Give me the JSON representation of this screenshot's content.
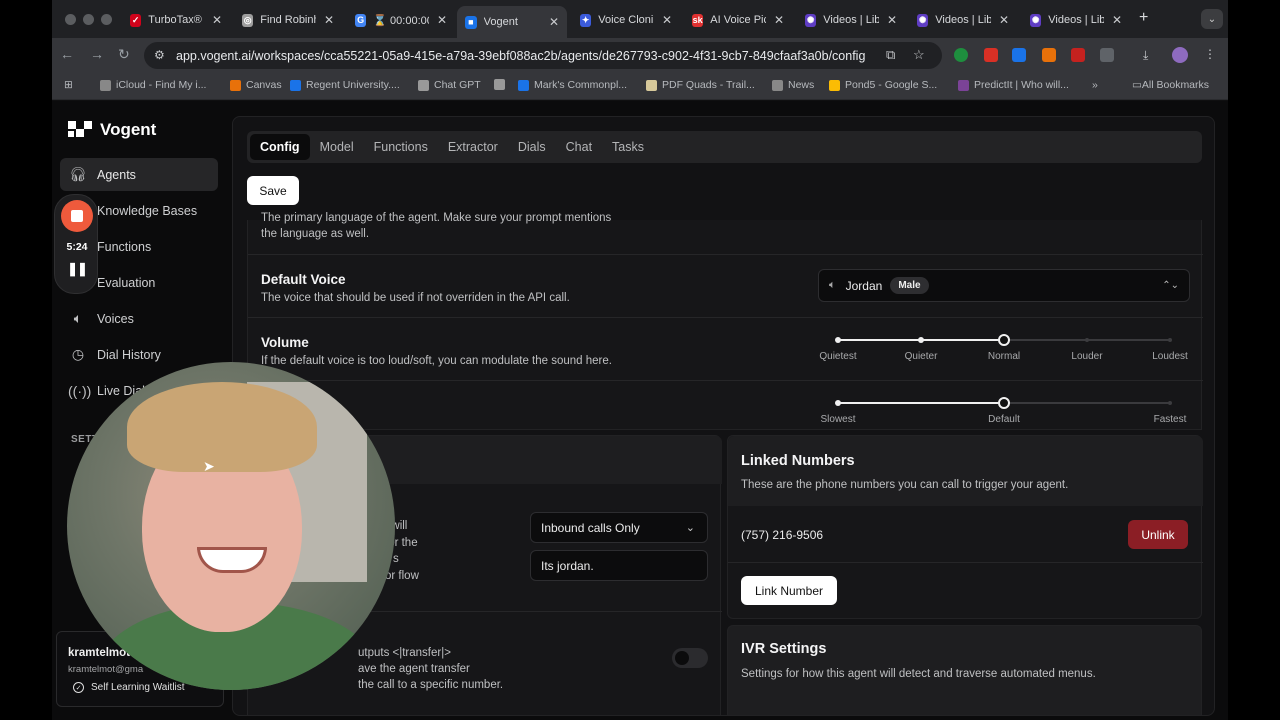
{
  "browser": {
    "tabs": [
      {
        "label": "TurboTax® L",
        "fav_color": "#d0021b",
        "fav_glyph": "✓"
      },
      {
        "label": "Find Robinh",
        "fav_color": "#9e9e9e",
        "fav_glyph": "◎"
      },
      {
        "label": "⌛ 00:00:00",
        "fav_color": "#4285f4",
        "fav_glyph": "G"
      },
      {
        "label": "Vogent",
        "fav_color": "#1a73e8",
        "fav_glyph": "■",
        "active": true
      },
      {
        "label": "Voice Cloni",
        "fav_color": "#3b5bdb",
        "fav_glyph": "✦"
      },
      {
        "label": "AI Voice Pic",
        "fav_color": "#e03131",
        "fav_glyph": "sk"
      },
      {
        "label": "Videos | Lib",
        "fav_color": "#5f3dc4",
        "fav_glyph": "✺"
      },
      {
        "label": "Videos | Lib",
        "fav_color": "#5f3dc4",
        "fav_glyph": "✺"
      },
      {
        "label": "Videos | Lib",
        "fav_color": "#5f3dc4",
        "fav_glyph": "✺"
      }
    ],
    "url": "app.vogent.ai/workspaces/cca55221-05a9-415e-a79a-39ebf088ac2b/agents/de267793-c902-4f31-9cb7-849cfaaf3a0b/config",
    "bookmarks": [
      "iCloud - Find My i...",
      "Canvas",
      "Regent University....",
      "Chat GPT",
      "",
      "Mark's Commonpl...",
      "PDF Quads - Trail...",
      "News",
      "Pond5 - Google S...",
      "PredictIt | Who will...",
      "»",
      "All Bookmarks"
    ]
  },
  "app": {
    "brand": "Vogent",
    "sidebar": [
      {
        "label": "Agents",
        "icon": "headphones-icon",
        "glyph": "🎧︎",
        "active": true
      },
      {
        "label": "Knowledge Bases",
        "icon": "book-icon",
        "glyph": "▤"
      },
      {
        "label": "Functions",
        "icon": "function-icon",
        "glyph": "ƒ"
      },
      {
        "label": "Evaluation",
        "icon": "chart-icon",
        "glyph": "◷"
      },
      {
        "label": "Voices",
        "icon": "speaker-icon",
        "glyph": "🔈︎"
      },
      {
        "label": "Dial History",
        "icon": "clock-icon",
        "glyph": "◷"
      },
      {
        "label": "Live Dials",
        "icon": "broadcast-icon",
        "glyph": "((·))"
      }
    ],
    "settings_header": "SETT",
    "recorder": {
      "time": "5:24"
    },
    "user": {
      "name": "kramtelmot",
      "email": "kramtelmot@gma",
      "waitlist": "Self Learning Waitlist"
    }
  },
  "main": {
    "tabs": [
      "Config",
      "Model",
      "Functions",
      "Extractor",
      "Dials",
      "Chat",
      "Tasks"
    ],
    "active_tab": "Config",
    "save_label": "Save",
    "language_desc_line1": "The primary language of the agent. Make sure your prompt mentions",
    "language_desc_line2": "the language as well.",
    "default_voice": {
      "title": "Default Voice",
      "desc": "The voice that should be used if not overriden in the API call.",
      "value": "Jordan",
      "badge": "Male"
    },
    "volume": {
      "title": "Volume",
      "desc": "If the default voice is too loud/soft, you can modulate the sound here.",
      "labels": [
        "Quietest",
        "Quieter",
        "Normal",
        "Louder",
        "Loudest"
      ],
      "selected_index": 2
    },
    "speed": {
      "labels": [
        "Slowest",
        "Default",
        "Fastest"
      ],
      "selected_fraction": 0.5
    },
    "inbound": {
      "desc_fragments": [
        "t will",
        "for the",
        "s",
        "or flow"
      ],
      "select_value": "Inbound calls Only",
      "input_value": "Its jordan."
    },
    "transfer": {
      "desc_line1": "utputs <|transfer|>",
      "desc_line2": "ave the agent transfer",
      "desc_line3": "the call to a specific number."
    },
    "linked_numbers": {
      "title": "Linked Numbers",
      "desc": "These are the phone numbers you can call to trigger your agent.",
      "number": "(757) 216-9506",
      "unlink_label": "Unlink",
      "link_label": "Link Number"
    },
    "ivr": {
      "title": "IVR Settings",
      "desc": "Settings for how this agent will detect and traverse automated menus."
    }
  }
}
